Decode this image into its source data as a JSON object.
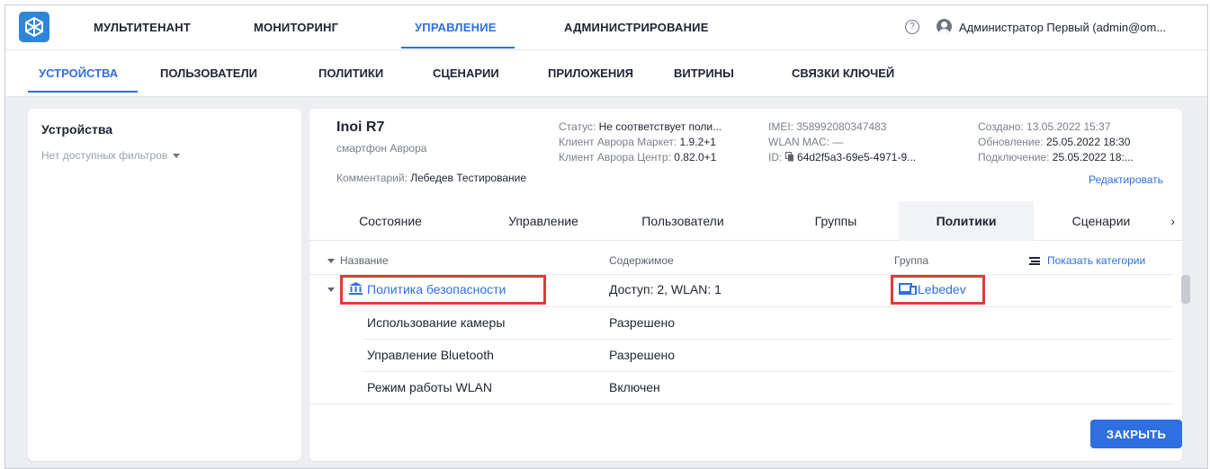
{
  "top_nav": {
    "items": [
      {
        "label": "МУЛЬТИТЕНАНТ",
        "active": false
      },
      {
        "label": "МОНИТОРИНГ",
        "active": false
      },
      {
        "label": "УПРАВЛЕНИЕ",
        "active": true
      },
      {
        "label": "АДМИНИСТРИРОВАНИЕ",
        "active": false
      }
    ],
    "user_name": "Администратор Первый (admin@om...",
    "help_glyph": "?",
    "accent_color": "#2f6fde"
  },
  "sub_nav": {
    "items": [
      {
        "label": "УСТРОЙСТВА",
        "active": true
      },
      {
        "label": "ПОЛЬЗОВАТЕЛИ",
        "active": false
      },
      {
        "label": "ПОЛИТИКИ",
        "active": false
      },
      {
        "label": "СЦЕНАРИИ",
        "active": false
      },
      {
        "label": "ПРИЛОЖЕНИЯ",
        "active": false
      },
      {
        "label": "ВИТРИНЫ",
        "active": false
      },
      {
        "label": "СВЯЗКИ КЛЮЧЕЙ",
        "active": false
      }
    ]
  },
  "left_panel": {
    "title": "Устройства",
    "filter_text": "Нет доступных фильтров"
  },
  "device": {
    "name": "Inoi R7",
    "type": "смартфон Аврора",
    "comment_label": "Комментарий:",
    "comment_value": "Лебедев Тестирование",
    "status_label": "Статус:",
    "status_value": "Не соответствует поли...",
    "market_label": "Клиент Аврора Маркет:",
    "market_value": "1.9.2+1",
    "center_label": "Клиент Аврора Центр:",
    "center_value": "0.82.0+1",
    "imei_label": "IMEI:",
    "imei_value": "358992080347483",
    "wlan_label": "WLAN MAC:",
    "wlan_value": "—",
    "id_label": "ID:",
    "id_value": "64d2f5a3-69e5-4971-9...",
    "created_label": "Создано:",
    "created_value": "13.05.2022 15:37",
    "updated_label": "Обновление:",
    "updated_value": "25.05.2022 18:30",
    "connected_label": "Подключение:",
    "connected_value": "25.05.2022 18:...",
    "edit_label": "Редактировать"
  },
  "tabs": [
    {
      "label": "Состояние",
      "active": false
    },
    {
      "label": "Управление",
      "active": false
    },
    {
      "label": "Пользователи",
      "active": false
    },
    {
      "label": "Группы",
      "active": false
    },
    {
      "label": "Политики",
      "active": true
    },
    {
      "label": "Сценарии",
      "active": false
    }
  ],
  "table": {
    "headers": {
      "name": "Название",
      "content": "Содержимое",
      "group": "Группа"
    },
    "show_categories": "Показать категории",
    "policy": {
      "name": "Политика безопасности",
      "content": "Доступ: 2, WLAN: 1",
      "group": "Lebedev",
      "highlight_color": "#e03a3a"
    },
    "rows": [
      {
        "name": "Использование камеры",
        "value": "Разрешено"
      },
      {
        "name": "Управление Bluetooth",
        "value": "Разрешено"
      },
      {
        "name": "Режим работы WLAN",
        "value": "Включен"
      }
    ]
  },
  "close_label": "ЗАКРЫТЬ"
}
